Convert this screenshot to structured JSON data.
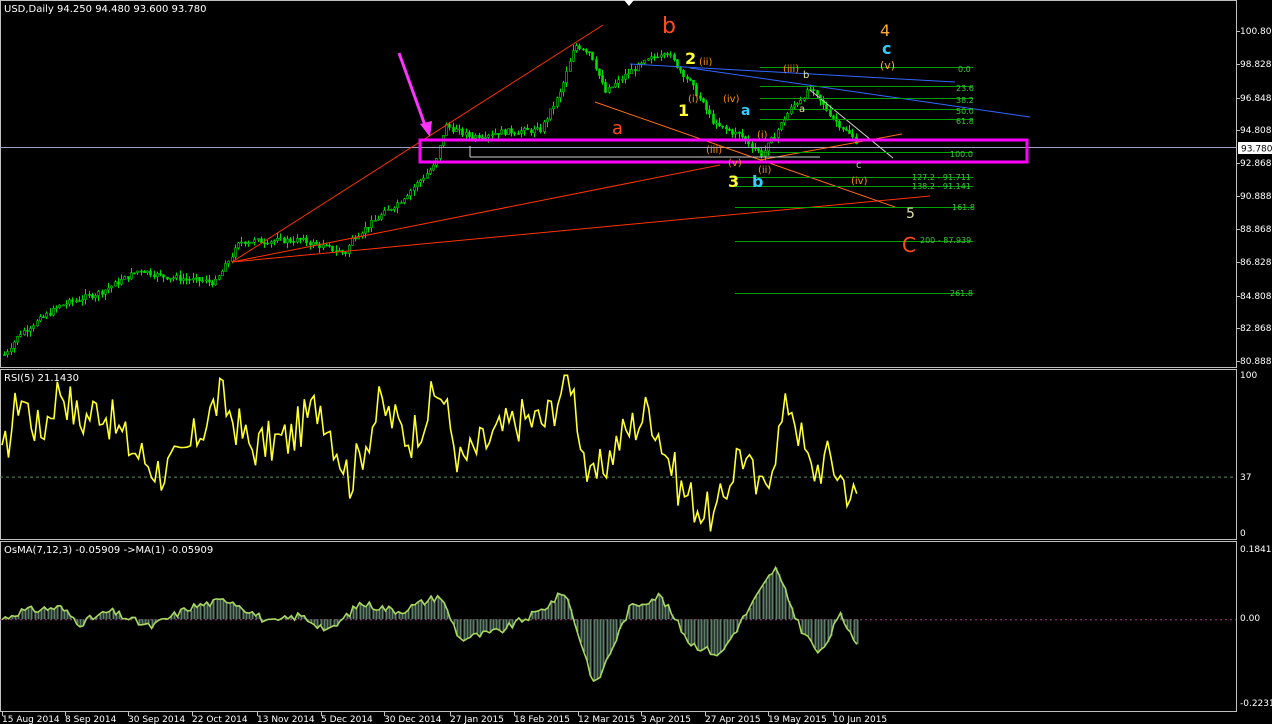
{
  "colors": {
    "background": "#000000",
    "frame": "#c0c0c0",
    "candle": "#00e000",
    "rsi_line": "#ffff33",
    "osma_line": "#a8d860",
    "osma_bar": "#5e7e6a",
    "highlight_box": "#ff00ff",
    "arrow": "#ff33ff",
    "trendline_red": "#ff3300",
    "trendline_blue": "#3366ff",
    "fib_line": "#00a000",
    "fib_text": "#33cc33"
  },
  "main_panel": {
    "title": "USD,Daily  94.250 94.480 93.600 93.780",
    "current_price": "93.780",
    "y_ticks": [
      "100.808",
      "98.828",
      "96.848",
      "94.808",
      "92.868",
      "90.888",
      "88.868",
      "86.828",
      "84.808",
      "82.868",
      "80.888"
    ]
  },
  "rsi_panel": {
    "title": "RSI(5) 21.1430",
    "y_ticks": [
      "100",
      "37",
      "0"
    ]
  },
  "osma_panel": {
    "title": "OsMA(7,12,3) -0.05909  ->MA(1) -0.05909",
    "y_ticks": [
      "0.18413",
      "0.00",
      "-0.22312"
    ]
  },
  "x_axis": {
    "labels": [
      "15 Aug 2014",
      "8 Sep 2014",
      "30 Sep 2014",
      "22 Oct 2014",
      "13 Nov 2014",
      "5 Dec 2014",
      "30 Dec 2014",
      "27 Jan 2015",
      "18 Feb 2015",
      "12 Mar 2015",
      "3 Apr 2015",
      "27 Apr 2015",
      "19 May 2015",
      "10 Jun 2015"
    ]
  },
  "fib_labels": [
    "0.0",
    "23.6",
    "38.2",
    "50.0",
    "61.8",
    "100.0",
    "127.2 - 91.711",
    "138.2 - 91.141",
    "161.8",
    "200 - 87.939",
    "261.8"
  ],
  "wave_labels": {
    "b_red": "b",
    "a_red": "a",
    "c_red": "C",
    "two_y": "2",
    "one_y": "1",
    "three_y": "3",
    "four_o": "4",
    "c_blue": "c",
    "a_blue": "a",
    "b_blue": "b",
    "five_w": "5",
    "i_top": "(i)",
    "ii_top": "(ii)",
    "iii_top": "(iii)",
    "iv_top": "(iv)",
    "v_top": "(v)",
    "i_bot": "(i)",
    "ii_bot": "(ii)",
    "iii_bot": "(iii)",
    "iv_bot": "(iv)",
    "v_bot": "(v)",
    "a_small": "a",
    "b_small": "b",
    "c_small": "c"
  },
  "chart_data": [
    {
      "type": "candlestick",
      "title": "USD,Daily",
      "ohlc_last": {
        "open": 94.25,
        "high": 94.48,
        "low": 93.6,
        "close": 93.78
      },
      "ylim": [
        80.3,
        101.8
      ],
      "x": [
        "15 Aug 2014",
        "8 Sep 2014",
        "30 Sep 2014",
        "22 Oct 2014",
        "13 Nov 2014",
        "5 Dec 2014",
        "30 Dec 2014",
        "27 Jan 2015",
        "18 Feb 2015",
        "12 Mar 2015",
        "3 Apr 2015",
        "27 Apr 2015",
        "19 May 2015",
        "10 Jun 2015"
      ],
      "close_approx": [
        81.6,
        83.9,
        85.8,
        86.3,
        87.8,
        88.3,
        90.6,
        94.7,
        94.5,
        99.8,
        97.8,
        94.9,
        95.6,
        94.2
      ],
      "fibonacci": [
        "0.0",
        "23.6",
        "38.2",
        "50.0",
        "61.8",
        "100.0",
        "127.2",
        "138.2",
        "161.8",
        "200",
        "261.8"
      ]
    },
    {
      "type": "line",
      "title": "RSI(5) 21.1430",
      "ylim": [
        0,
        100
      ],
      "level": 37,
      "x": [
        "15 Aug 2014",
        "8 Sep 2014",
        "30 Sep 2014",
        "22 Oct 2014",
        "13 Nov 2014",
        "5 Dec 2014",
        "30 Dec 2014",
        "27 Jan 2015",
        "18 Feb 2015",
        "12 Mar 2015",
        "3 Apr 2015",
        "27 Apr 2015",
        "19 May 2015",
        "10 Jun 2015"
      ],
      "values": [
        50,
        85,
        62,
        88,
        60,
        45,
        80,
        55,
        52,
        95,
        35,
        20,
        80,
        21
      ]
    },
    {
      "type": "bar",
      "title": "OsMA(7,12,3) -0.05909",
      "ylim": [
        -0.22312,
        0.18413
      ],
      "x": [
        "15 Aug 2014",
        "8 Sep 2014",
        "30 Sep 2014",
        "22 Oct 2014",
        "13 Nov 2014",
        "5 Dec 2014",
        "30 Dec 2014",
        "27 Jan 2015",
        "18 Feb 2015",
        "12 Mar 2015",
        "3 Apr 2015",
        "27 Apr 2015",
        "19 May 2015",
        "10 Jun 2015"
      ],
      "values": [
        0.01,
        0.02,
        -0.01,
        0.04,
        -0.02,
        0.03,
        0.02,
        -0.05,
        0.01,
        0.06,
        -0.03,
        -0.04,
        0.1,
        -0.059
      ]
    }
  ]
}
